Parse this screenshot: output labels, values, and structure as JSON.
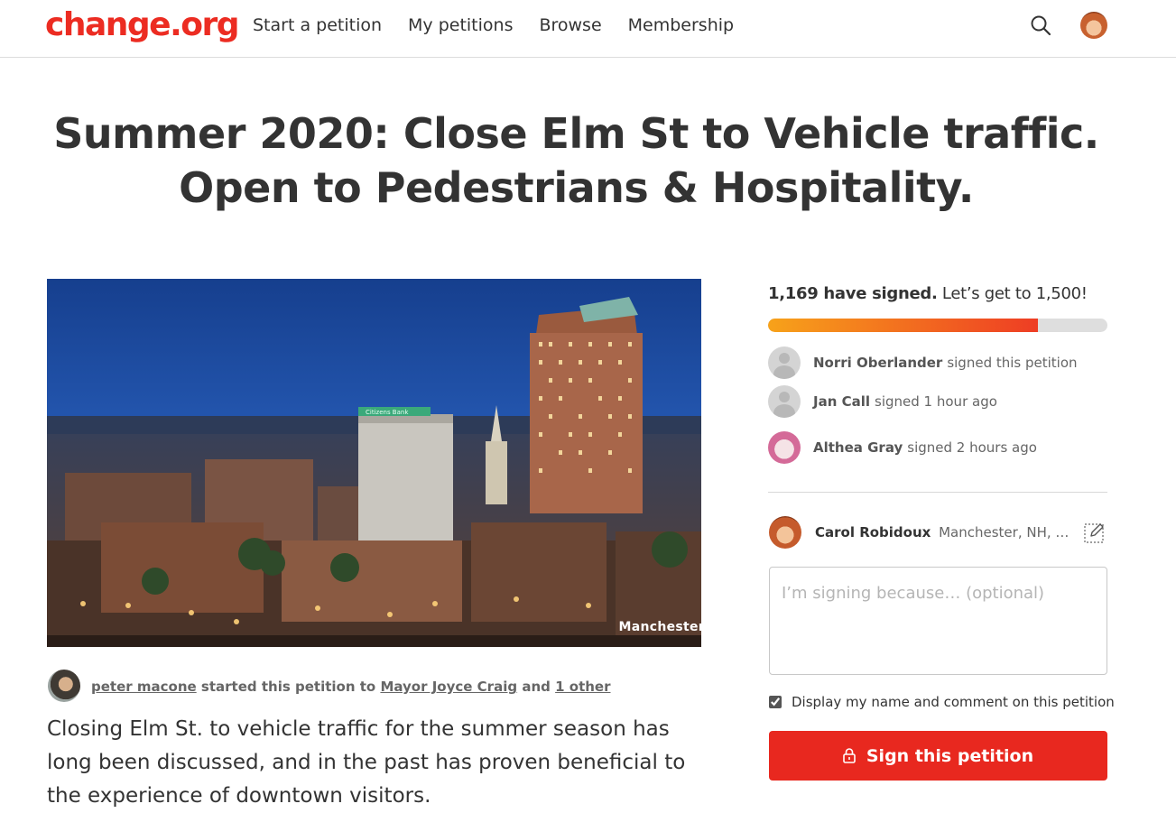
{
  "header": {
    "logo": "change.org",
    "nav": [
      "Start a petition",
      "My petitions",
      "Browse",
      "Membership"
    ],
    "icons": {
      "search": "search-icon",
      "avatar": "user-avatar"
    }
  },
  "petition": {
    "title": "Summer 2020: Close Elm St to Vehicle traffic. Open to Pedestrians & Hospitality.",
    "image_caption": "Manchester",
    "image_sign_text": "Citizens Bank",
    "starter": {
      "name": "peter macone",
      "started_text": "started this petition to",
      "target": "Mayor Joyce Craig",
      "and_text": "and",
      "others": "1 other"
    },
    "description": "Closing Elm St. to vehicle traffic for the summer season has long been discussed, and in the past has proven beneficial to the experience of downtown visitors."
  },
  "signatures": {
    "count_text": "1,169 have signed.",
    "goal_text": "Let’s get to 1,500!",
    "signed": 1169,
    "goal": 1500,
    "progress_fraction": 0.795,
    "bar_colors": {
      "start": "#f7a21a",
      "end": "#ee3d24",
      "track": "#dedede"
    },
    "recent": [
      {
        "name": "Norri Oberlander",
        "action": "signed this petition",
        "avatar": "default-avatar"
      },
      {
        "name": "Jan Call",
        "action": "signed 1 hour ago",
        "avatar": "default-avatar"
      },
      {
        "name": "Althea Gray",
        "action": "signed 2 hours ago",
        "avatar": "photo-avatar"
      }
    ]
  },
  "sign_form": {
    "user_name": "Carol Robidoux",
    "user_location": "Manchester, NH, Unit…",
    "comment_placeholder": "I’m signing because… (optional)",
    "display_checkbox_label": "Display my name and comment on this petition",
    "display_checked": true,
    "button_label": "Sign this petition",
    "button_color": "#e8281f"
  }
}
